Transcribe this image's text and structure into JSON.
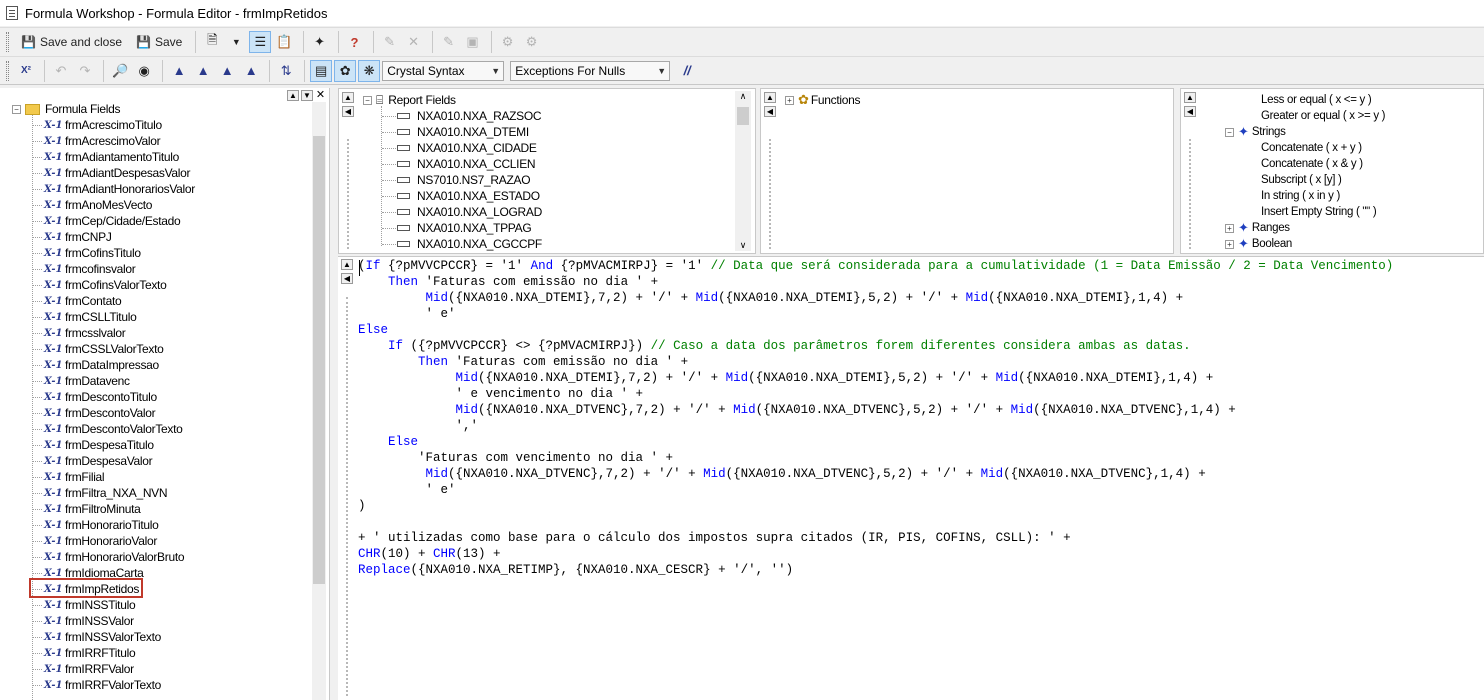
{
  "window": {
    "title": "Formula Workshop - Formula Editor - frmImpRetidos"
  },
  "toolbar1": {
    "save_close_label": "Save and close",
    "save_label": "Save"
  },
  "toolbar2": {
    "syntax_select": "Crystal Syntax",
    "nulls_select": "Exceptions For Nulls",
    "comment_label": "//"
  },
  "left_tree": {
    "root_label": "Formula Fields",
    "items": [
      "frmAcrescimoTitulo",
      "frmAcrescimoValor",
      "frmAdiantamentoTitulo",
      "frmAdiantDespesasValor",
      "frmAdiantHonorariosValor",
      "frmAnoMesVecto",
      "frmCep/Cidade/Estado",
      "frmCNPJ",
      "frmCofinsTitulo",
      "frmcofinsvalor",
      "frmCofinsValorTexto",
      "frmContato",
      "frmCSLLTitulo",
      "frmcsslvalor",
      "frmCSSLValorTexto",
      "frmDataImpressao",
      "frmDatavenc",
      "frmDescontoTitulo",
      "frmDescontoValor",
      "frmDescontoValorTexto",
      "frmDespesaTitulo",
      "frmDespesaValor",
      "frmFilial",
      "frmFiltra_NXA_NVN",
      "frmFiltroMinuta",
      "frmHonorarioTitulo",
      "frmHonorarioValor",
      "frmHonorarioValorBruto",
      "frmIdiomaCarta",
      "frmImpRetidos",
      "frmINSSTitulo",
      "frmINSSValor",
      "frmINSSValorTexto",
      "frmIRRFTitulo",
      "frmIRRFValor",
      "frmIRRFValorTexto"
    ],
    "selected": "frmImpRetidos"
  },
  "report_fields": {
    "header": "Report Fields",
    "items": [
      "NXA010.NXA_RAZSOC",
      "NXA010.NXA_DTEMI",
      "NXA010.NXA_CIDADE",
      "NXA010.NXA_CCLIEN",
      "NS7010.NS7_RAZAO",
      "NXA010.NXA_ESTADO",
      "NXA010.NXA_LOGRAD",
      "NXA010.NXA_TPPAG",
      "NXA010.NXA_CGCCPF"
    ]
  },
  "functions": {
    "header": "Functions"
  },
  "operators": {
    "items": [
      {
        "label": "Less or equal ( x <= y )",
        "level": 2
      },
      {
        "label": "Greater or equal ( x >= y )",
        "level": 2
      },
      {
        "label": "Strings",
        "level": 1,
        "expanded": true
      },
      {
        "label": "Concatenate ( x + y )",
        "level": 2
      },
      {
        "label": "Concatenate ( x & y )",
        "level": 2
      },
      {
        "label": "Subscript ( x [y] )",
        "level": 2
      },
      {
        "label": "In string ( x in y )",
        "level": 2
      },
      {
        "label": "Insert Empty String ( \"\" )",
        "level": 2
      },
      {
        "label": "Ranges",
        "level": 1,
        "expanded": false
      },
      {
        "label": "Boolean",
        "level": 1,
        "expanded": false
      }
    ]
  },
  "code": {
    "lines": [
      [
        [
          "p",
          "("
        ],
        [
          "k",
          "If"
        ],
        [
          "p",
          " {?pMVVCPCCR} = '1' "
        ],
        [
          "k",
          "And"
        ],
        [
          "p",
          " {?pMVACMIRPJ} = '1' "
        ],
        [
          "c",
          "// Data que será considerada para a cumulatividade (1 = Data Emissão / 2 = Data Vencimento)"
        ]
      ],
      [
        [
          "p",
          "    "
        ],
        [
          "k",
          "Then"
        ],
        [
          "p",
          " 'Faturas com emissão no dia ' +"
        ]
      ],
      [
        [
          "p",
          "         "
        ],
        [
          "k",
          "Mid"
        ],
        [
          "p",
          "({NXA010.NXA_DTEMI},7,2) + '/' + "
        ],
        [
          "k",
          "Mid"
        ],
        [
          "p",
          "({NXA010.NXA_DTEMI},5,2) + '/' + "
        ],
        [
          "k",
          "Mid"
        ],
        [
          "p",
          "({NXA010.NXA_DTEMI},1,4) +"
        ]
      ],
      [
        [
          "p",
          "         ' e'"
        ]
      ],
      [
        [
          "k",
          "Else"
        ]
      ],
      [
        [
          "p",
          "    "
        ],
        [
          "k",
          "If"
        ],
        [
          "p",
          " ({?pMVVCPCCR} <> {?pMVACMIRPJ}) "
        ],
        [
          "c",
          "// Caso a data dos parâmetros forem diferentes considera ambas as datas."
        ]
      ],
      [
        [
          "p",
          "        "
        ],
        [
          "k",
          "Then"
        ],
        [
          "p",
          " 'Faturas com emissão no dia ' +"
        ]
      ],
      [
        [
          "p",
          "             "
        ],
        [
          "k",
          "Mid"
        ],
        [
          "p",
          "({NXA010.NXA_DTEMI},7,2) + '/' + "
        ],
        [
          "k",
          "Mid"
        ],
        [
          "p",
          "({NXA010.NXA_DTEMI},5,2) + '/' + "
        ],
        [
          "k",
          "Mid"
        ],
        [
          "p",
          "({NXA010.NXA_DTEMI},1,4) +"
        ]
      ],
      [
        [
          "p",
          "             ' e vencimento no dia ' +"
        ]
      ],
      [
        [
          "p",
          "             "
        ],
        [
          "k",
          "Mid"
        ],
        [
          "p",
          "({NXA010.NXA_DTVENC},7,2) + '/' + "
        ],
        [
          "k",
          "Mid"
        ],
        [
          "p",
          "({NXA010.NXA_DTVENC},5,2) + '/' + "
        ],
        [
          "k",
          "Mid"
        ],
        [
          "p",
          "({NXA010.NXA_DTVENC},1,4) +"
        ]
      ],
      [
        [
          "p",
          "             ','"
        ]
      ],
      [
        [
          "p",
          "    "
        ],
        [
          "k",
          "Else"
        ]
      ],
      [
        [
          "p",
          "        'Faturas com vencimento no dia ' +"
        ]
      ],
      [
        [
          "p",
          "         "
        ],
        [
          "k",
          "Mid"
        ],
        [
          "p",
          "({NXA010.NXA_DTVENC},7,2) + '/' + "
        ],
        [
          "k",
          "Mid"
        ],
        [
          "p",
          "({NXA010.NXA_DTVENC},5,2) + '/' + "
        ],
        [
          "k",
          "Mid"
        ],
        [
          "p",
          "({NXA010.NXA_DTVENC},1,4) +"
        ]
      ],
      [
        [
          "p",
          "         ' e'"
        ]
      ],
      [
        [
          "p",
          ")"
        ]
      ],
      [
        [
          "p",
          ""
        ]
      ],
      [
        [
          "p",
          "+ ' utilizadas como base para o cálculo dos impostos supra citados (IR, PIS, COFINS, CSLL): ' +"
        ]
      ],
      [
        [
          "k",
          "CHR"
        ],
        [
          "p",
          "(10) + "
        ],
        [
          "k",
          "CHR"
        ],
        [
          "p",
          "(13) +"
        ]
      ],
      [
        [
          "k",
          "Replace"
        ],
        [
          "p",
          "({NXA010.NXA_RETIMP}, {NXA010.NXA_CESCR} + '/', '')"
        ]
      ]
    ]
  },
  "colors": {
    "keyword": "#0000ff",
    "comment": "#008000",
    "selection_outline": "#c0392b",
    "toolbar_active": "#cce4f7"
  }
}
